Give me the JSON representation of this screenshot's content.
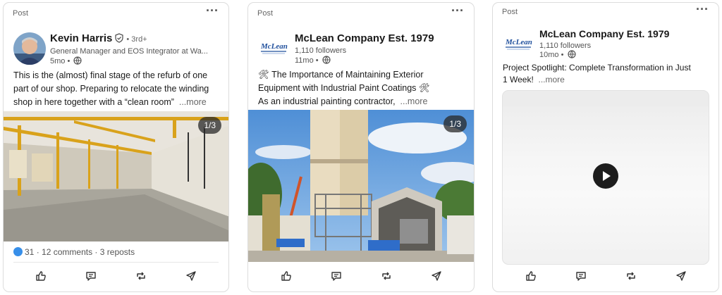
{
  "posts": [
    {
      "label": "Post",
      "author": "Kevin Harris",
      "degree": "• 3rd+",
      "headline": "General Manager and EOS Integrator at Wa...",
      "time": "5mo •",
      "body_lines": [
        "This is the (almost) final stage of the refurb of one",
        "part of our shop. Preparing to relocate the winding",
        "shop in here together with a “clean room”"
      ],
      "more": "...more",
      "image_counter": "1/3",
      "reactions": "31",
      "comments": "12 comments",
      "reposts": "3 reposts",
      "stats_sep": "·"
    },
    {
      "label": "Post",
      "author": "McLean Company Est. 1979",
      "followers": "1,110 followers",
      "time": "11mo •",
      "body_lines": [
        "🛠 The Importance of Maintaining Exterior",
        "Equipment with Industrial Paint Coatings 🛠",
        "As an industrial painting contractor,"
      ],
      "more": "...more",
      "image_counter": "1/3"
    },
    {
      "label": "Post",
      "author": "McLean Company Est. 1979",
      "followers": "1,110 followers",
      "time": "10mo •",
      "body_lines": [
        "Project Spotlight: Complete Transformation in Just",
        "1 Week!"
      ],
      "more": "...more"
    }
  ],
  "logo_text": "McLean",
  "icons": [
    "more-dots-icon",
    "verified-icon",
    "globe-icon",
    "like-icon",
    "comment-icon",
    "repost-icon",
    "send-icon",
    "play-icon"
  ],
  "colors": {
    "like_blue": "#378fe9",
    "text": "#191919",
    "muted": "#666666"
  }
}
